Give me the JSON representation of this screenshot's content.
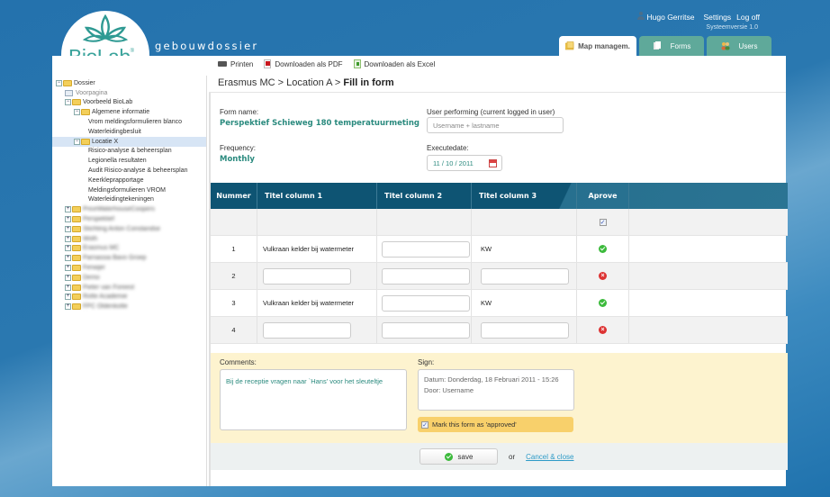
{
  "brand": {
    "logo_text": "BioLab",
    "app_name": "gebouwdossier",
    "accent": "#3aa39b"
  },
  "user_bar": {
    "user": "Hugo Gerritse",
    "settings": "Settings",
    "logoff": "Log off",
    "version": "Systeemversie 1.0"
  },
  "tabs": [
    {
      "label": "Map managem.",
      "icon": "folder-icon",
      "active": true
    },
    {
      "label": "Forms",
      "icon": "documents-icon",
      "active": false
    },
    {
      "label": "Users",
      "icon": "users-icon",
      "active": false
    }
  ],
  "toolbar": {
    "print": "Printen",
    "pdf": "Downloaden als PDF",
    "excel": "Downloaden als Excel"
  },
  "tree": [
    {
      "label": "Dossier",
      "level": 0,
      "type": "folder",
      "expanded": true
    },
    {
      "label": "Voorpagina",
      "level": 1,
      "type": "page"
    },
    {
      "label": "Voorbeeld BioLab",
      "level": 1,
      "type": "folder",
      "expanded": true
    },
    {
      "label": "Algemene informatie",
      "level": 2,
      "type": "folder",
      "expanded": true
    },
    {
      "label": "Vrom meldingsformulieren blanco",
      "level": 3,
      "type": "leaf"
    },
    {
      "label": "Waterleidingbesluit",
      "level": 3,
      "type": "leaf"
    },
    {
      "label": "Locatie X",
      "level": 2,
      "type": "folder",
      "expanded": true,
      "selected": true
    },
    {
      "label": "Risico-analyse & beheersplan",
      "level": 3,
      "type": "leaf"
    },
    {
      "label": "Legionella resultaten",
      "level": 3,
      "type": "leaf"
    },
    {
      "label": "Audit Risico-analyse & beheersplan",
      "level": 3,
      "type": "leaf"
    },
    {
      "label": "Keerkleprapportage",
      "level": 3,
      "type": "leaf"
    },
    {
      "label": "Meldingsformulieren VROM",
      "level": 3,
      "type": "leaf"
    },
    {
      "label": "Waterleidingtekeningen",
      "level": 3,
      "type": "leaf"
    },
    {
      "label": "PriceWaterhouseCoopers",
      "level": 1,
      "type": "folder",
      "blurred": true
    },
    {
      "label": "Perspektief",
      "level": 1,
      "type": "folder",
      "blurred": true
    },
    {
      "label": "Stichting Anton Constandse",
      "level": 1,
      "type": "folder",
      "blurred": true
    },
    {
      "label": "Woth",
      "level": 1,
      "type": "folder",
      "blurred": true
    },
    {
      "label": "Erasmus MC",
      "level": 1,
      "type": "folder",
      "blurred": true
    },
    {
      "label": "Parnassia Bavo Groep",
      "level": 1,
      "type": "folder",
      "blurred": true
    },
    {
      "label": "Ferwijer",
      "level": 1,
      "type": "folder",
      "blurred": true
    },
    {
      "label": "Demo",
      "level": 1,
      "type": "folder",
      "blurred": true
    },
    {
      "label": "Pieter van Foreest",
      "level": 1,
      "type": "folder",
      "blurred": true
    },
    {
      "label": "Rotte Academie",
      "level": 1,
      "type": "folder",
      "blurred": true
    },
    {
      "label": "FPC Oldenkotte",
      "level": 1,
      "type": "folder",
      "blurred": true
    }
  ],
  "breadcrumb": {
    "path": "Erasmus MC > Location A > ",
    "current": "Fill in form"
  },
  "form": {
    "form_name_label": "Form name:",
    "form_name": "Perspektief Schieweg 180 temperatuurmeting",
    "frequency_label": "Frequency:",
    "frequency": "Monthly",
    "user_label": "User performing (current logged in user)",
    "user_placeholder": "Username + lastname",
    "date_label": "Executedate:",
    "date_value": "11 / 10 / 2011"
  },
  "grid": {
    "headers": [
      "Nummer",
      "Titel column 1",
      "Titel column 2",
      "Titel column 3",
      "Aprove"
    ],
    "rows": [
      {
        "num": "",
        "col1": "",
        "col2": "",
        "col3": "",
        "status": "checkbox"
      },
      {
        "num": "1",
        "col1": "Vulkraan kelder bij watermeter",
        "col2": "input",
        "col3": "KW",
        "status": "ok"
      },
      {
        "num": "2",
        "col1": "input",
        "col2": "input",
        "col3": "input",
        "status": "no"
      },
      {
        "num": "3",
        "col1": "Vulkraan kelder bij watermeter",
        "col2": "input",
        "col3": "KW",
        "status": "ok"
      },
      {
        "num": "4",
        "col1": "input",
        "col2": "input",
        "col3": "input",
        "status": "no"
      }
    ]
  },
  "comments": {
    "label": "Comments:",
    "text": "Bij de receptie vragen naar `Hans' voor het sleuteltje"
  },
  "sign": {
    "label": "Sign:",
    "line1": "Datum: Donderdag, 18 Februari 2011 - 15:26",
    "line2": "Door: Username",
    "approve_label": "Mark this form as 'approved'",
    "approve_checked": true
  },
  "actions": {
    "save": "save",
    "or": "or",
    "cancel": "Cancel & close"
  }
}
